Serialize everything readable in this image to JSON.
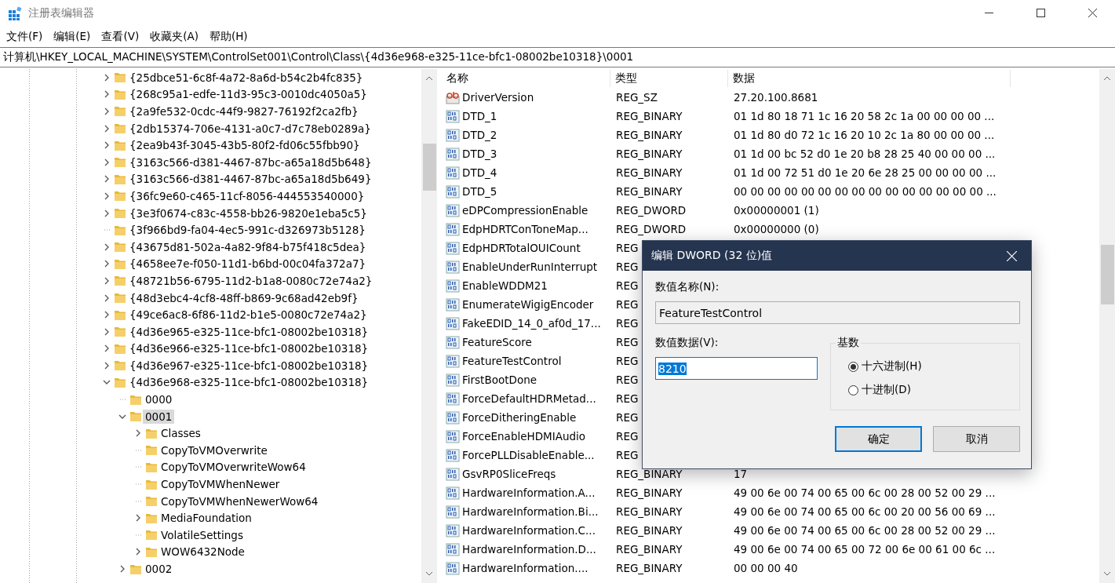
{
  "window": {
    "title": "注册表编辑器"
  },
  "menu": [
    {
      "label": "文件(F)"
    },
    {
      "label": "编辑(E)"
    },
    {
      "label": "查看(V)"
    },
    {
      "label": "收藏夹(A)"
    },
    {
      "label": "帮助(H)"
    }
  ],
  "address": "计算机\\HKEY_LOCAL_MACHINE\\SYSTEM\\ControlSet001\\Control\\Class\\{4d36e968-e325-11ce-bfc1-08002be10318}\\0001",
  "tree": [
    {
      "kind": "branch",
      "label": "{25dbce51-6c8f-4a72-8a6d-b54c2b4fc835}",
      "expanded": false,
      "selected": false
    },
    {
      "kind": "branch",
      "label": "{268c95a1-edfe-11d3-95c3-0010dc4050a5}",
      "expanded": false,
      "selected": false
    },
    {
      "kind": "branch",
      "label": "{2a9fe532-0cdc-44f9-9827-76192f2ca2fb}",
      "expanded": false,
      "selected": false
    },
    {
      "kind": "branch",
      "label": "{2db15374-706e-4131-a0c7-d7c78eb0289a}",
      "expanded": false,
      "selected": false
    },
    {
      "kind": "branch",
      "label": "{2ea9b43f-3045-43b5-80f2-fd06c55fbb90}",
      "expanded": false,
      "selected": false
    },
    {
      "kind": "branch",
      "label": "{3163c566-d381-4467-87bc-a65a18d5b648}",
      "expanded": false,
      "selected": false
    },
    {
      "kind": "branch",
      "label": "{3163c566-d381-4467-87bc-a65a18d5b649}",
      "expanded": false,
      "selected": false
    },
    {
      "kind": "branch",
      "label": "{36fc9e60-c465-11cf-8056-444553540000}",
      "expanded": false,
      "selected": false
    },
    {
      "kind": "branch",
      "label": "{3e3f0674-c83c-4558-bb26-9820e1eba5c5}",
      "expanded": false,
      "selected": false
    },
    {
      "kind": "leaf",
      "label": "{3f966bd9-fa04-4ec5-991c-d326973b5128}",
      "selected": false
    },
    {
      "kind": "branch",
      "label": "{43675d81-502a-4a82-9f84-b75f418c5dea}",
      "expanded": false,
      "selected": false
    },
    {
      "kind": "branch",
      "label": "{4658ee7e-f050-11d1-b6bd-00c04fa372a7}",
      "expanded": false,
      "selected": false
    },
    {
      "kind": "branch",
      "label": "{48721b56-6795-11d2-b1a8-0080c72e74a2}",
      "expanded": false,
      "selected": false
    },
    {
      "kind": "branch",
      "label": "{48d3ebc4-4cf8-48ff-b869-9c68ad42eb9f}",
      "expanded": false,
      "selected": false
    },
    {
      "kind": "branch",
      "label": "{49ce6ac8-6f86-11d2-b1e5-0080c72e74a2}",
      "expanded": false,
      "selected": false
    },
    {
      "kind": "branch",
      "label": "{4d36e965-e325-11ce-bfc1-08002be10318}",
      "expanded": false,
      "selected": false
    },
    {
      "kind": "branch",
      "label": "{4d36e966-e325-11ce-bfc1-08002be10318}",
      "expanded": false,
      "selected": false
    },
    {
      "kind": "branch",
      "label": "{4d36e967-e325-11ce-bfc1-08002be10318}",
      "expanded": false,
      "selected": false
    },
    {
      "kind": "branch",
      "label": "{4d36e968-e325-11ce-bfc1-08002be10318}",
      "expanded": true,
      "selected": false,
      "children": [
        {
          "kind": "leaf",
          "label": "0000",
          "selected": false
        },
        {
          "kind": "branch",
          "label": "0001",
          "expanded": true,
          "selected": true,
          "children": [
            {
              "kind": "branch",
              "label": "Classes",
              "expanded": false,
              "selected": false
            },
            {
              "kind": "leaf",
              "label": "CopyToVMOverwrite",
              "selected": false
            },
            {
              "kind": "leaf",
              "label": "CopyToVMOverwriteWow64",
              "selected": false
            },
            {
              "kind": "leaf",
              "label": "CopyToVMWhenNewer",
              "selected": false
            },
            {
              "kind": "leaf",
              "label": "CopyToVMWhenNewerWow64",
              "selected": false
            },
            {
              "kind": "branch",
              "label": "MediaFoundation",
              "expanded": false,
              "selected": false
            },
            {
              "kind": "leaf",
              "label": "VolatileSettings",
              "selected": false
            },
            {
              "kind": "branch",
              "label": "WOW6432Node",
              "expanded": false,
              "selected": false
            }
          ]
        },
        {
          "kind": "branch",
          "label": "0002",
          "expanded": false,
          "selected": false
        }
      ]
    }
  ],
  "columns": [
    "名称",
    "类型",
    "数据"
  ],
  "values": [
    {
      "kind": "string",
      "name": "DriverVersion",
      "type": "REG_SZ",
      "data": "27.20.100.8681"
    },
    {
      "kind": "binary",
      "name": "DTD_1",
      "type": "REG_BINARY",
      "data": "01 1d 80 18 71 1c 16 20 58 2c 1a 00 00 00 00 ..."
    },
    {
      "kind": "binary",
      "name": "DTD_2",
      "type": "REG_BINARY",
      "data": "01 1d 80 d0 72 1c 16 20 10 2c 1a 80 00 00 00 ..."
    },
    {
      "kind": "binary",
      "name": "DTD_3",
      "type": "REG_BINARY",
      "data": "01 1d 00 bc 52 d0 1e 20 b8 28 25 40 00 00 00 ..."
    },
    {
      "kind": "binary",
      "name": "DTD_4",
      "type": "REG_BINARY",
      "data": "01 1d 00 72 51 d0 1e 20 6e 28 25 00 00 00 00 ..."
    },
    {
      "kind": "binary",
      "name": "DTD_5",
      "type": "REG_BINARY",
      "data": "00 00 00 00 00 00 00 00 00 00 00 00 00 00 00 ..."
    },
    {
      "kind": "binary",
      "name": "eDPCompressionEnable",
      "type": "REG_DWORD",
      "data": "0x00000001 (1)"
    },
    {
      "kind": "binary",
      "name": "EdpHDRTConToneMap...",
      "type": "REG_DWORD",
      "data": "0x00000000 (0)"
    },
    {
      "kind": "binary",
      "name": "EdpHDRTotalOUICount",
      "type": "REG"
    },
    {
      "kind": "binary",
      "name": "EnableUnderRunInterrupt",
      "type": "REG"
    },
    {
      "kind": "binary",
      "name": "EnableWDDM21",
      "type": "REG"
    },
    {
      "kind": "binary",
      "name": "EnumerateWigigEncoder",
      "type": "REG"
    },
    {
      "kind": "binary",
      "name": "FakeEDID_14_0_af0d_17...",
      "type": "REG"
    },
    {
      "kind": "binary",
      "name": "FeatureScore",
      "type": "REG"
    },
    {
      "kind": "binary",
      "name": "FeatureTestControl",
      "type": "REG"
    },
    {
      "kind": "binary",
      "name": "FirstBootDone",
      "type": "REG"
    },
    {
      "kind": "binary",
      "name": "ForceDefaultHDRMetad...",
      "type": "REG"
    },
    {
      "kind": "binary",
      "name": "ForceDitheringEnable",
      "type": "REG"
    },
    {
      "kind": "binary",
      "name": "ForceEnableHDMIAudio",
      "type": "REG"
    },
    {
      "kind": "binary",
      "name": "ForcePLLDisableEnable...",
      "type": "REG"
    },
    {
      "kind": "binary",
      "name": "GsvRP0SliceFreqs",
      "type": "REG_BINARY",
      "data": "17"
    },
    {
      "kind": "binary",
      "name": "HardwareInformation.A...",
      "type": "REG_BINARY",
      "data": "49 00 6e 00 74 00 65 00 6c 00 28 00 52 00 29 ..."
    },
    {
      "kind": "binary",
      "name": "HardwareInformation.Bi...",
      "type": "REG_BINARY",
      "data": "49 00 6e 00 74 00 65 00 6c 00 20 00 56 00 69 ..."
    },
    {
      "kind": "binary",
      "name": "HardwareInformation.C...",
      "type": "REG_BINARY",
      "data": "49 00 6e 00 74 00 65 00 6c 00 28 00 52 00 29 ..."
    },
    {
      "kind": "binary",
      "name": "HardwareInformation.D...",
      "type": "REG_BINARY",
      "data": "49 00 6e 00 74 00 65 00 72 00 6e 00 61 00 6c ..."
    },
    {
      "kind": "binary",
      "name": "HardwareInformation....",
      "type": "REG_BINARY",
      "data": "00 00 00 40"
    }
  ],
  "dialog": {
    "title": "编辑 DWORD (32 位)值",
    "name_label": "数值名称(N):",
    "name_value": "FeatureTestControl",
    "data_label": "数值数据(V):",
    "data_value": "8210",
    "base_label": "基数",
    "radios": [
      {
        "label": "十六进制(H)",
        "selected": true
      },
      {
        "label": "十进制(D)",
        "selected": false
      }
    ],
    "buttons": [
      {
        "label": "确定",
        "default": true
      },
      {
        "label": "取消",
        "default": false
      }
    ]
  }
}
